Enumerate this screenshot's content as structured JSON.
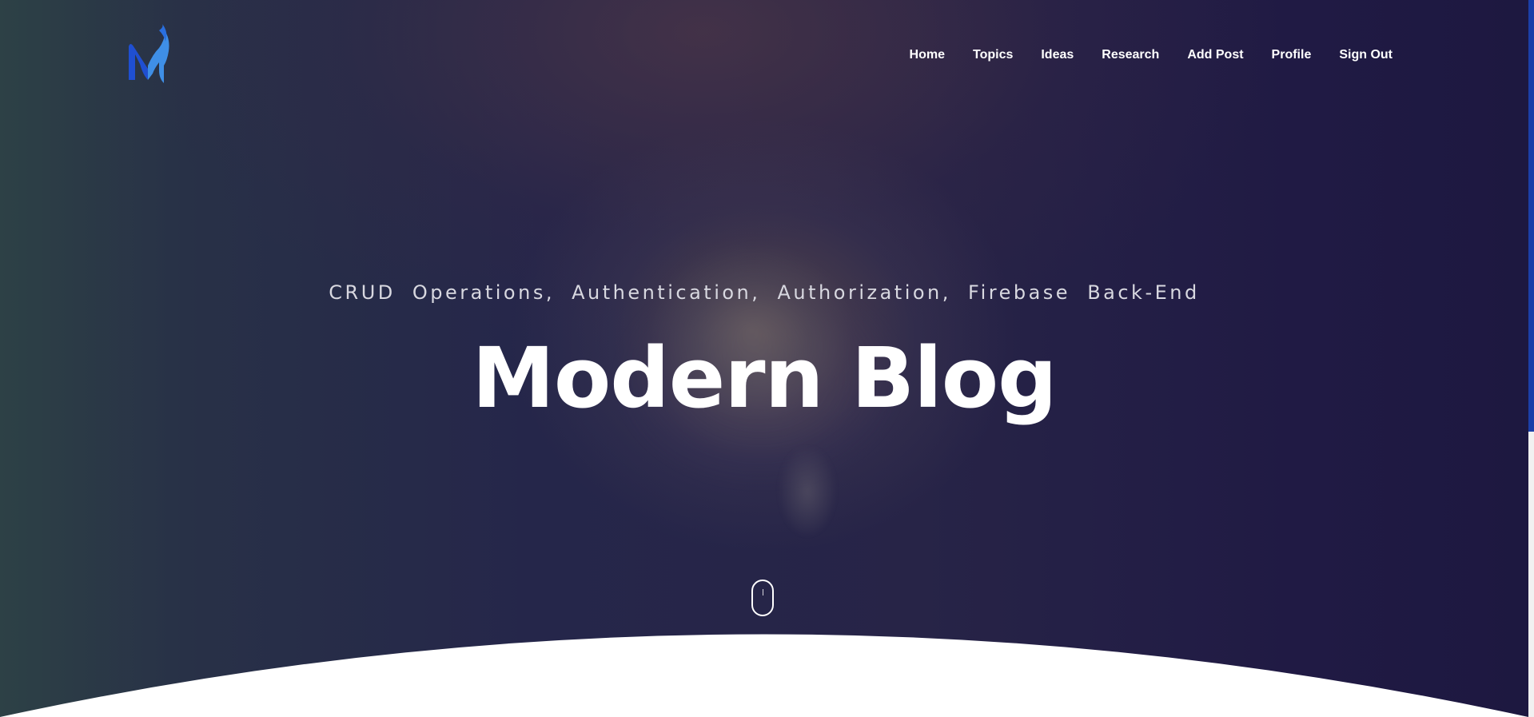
{
  "header": {
    "logo_icon": "stylized-m-logo",
    "nav": [
      {
        "label": "Home"
      },
      {
        "label": "Topics"
      },
      {
        "label": "Ideas"
      },
      {
        "label": "Research"
      },
      {
        "label": "Add Post"
      },
      {
        "label": "Profile"
      },
      {
        "label": "Sign Out"
      }
    ]
  },
  "hero": {
    "subtitle": "CRUD Operations, Authentication, Authorization, Firebase Back-End",
    "title": "Modern Blog",
    "background_image": "brain",
    "scroll_indicator_icon": "mouse-scroll-icon"
  },
  "colors": {
    "logo_primary": "#1f4fd1",
    "logo_secondary": "#3f8fe6",
    "text": "#ffffff",
    "subtitle": "#d8d8e0",
    "scrollbar_thumb": "#1b3fa8"
  }
}
